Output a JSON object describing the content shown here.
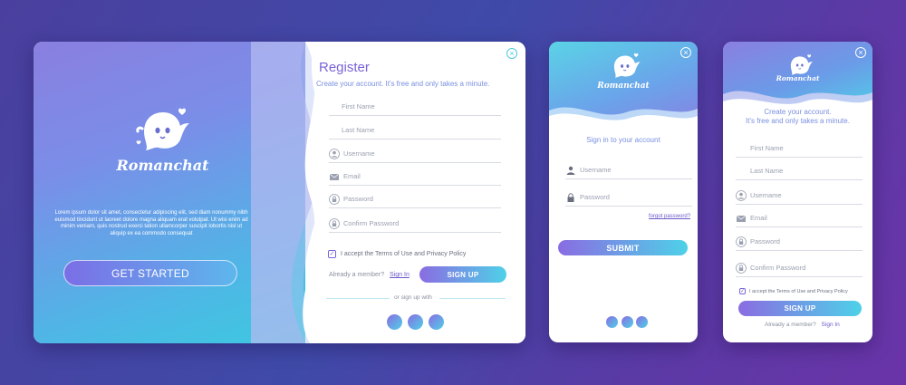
{
  "brand": {
    "name": "Romanchat"
  },
  "register_desktop": {
    "lorem": "Lorem ipsum dolor sit amet, consectetur adipiscing elit, sed diam nonummy nibh euismod tincidunt ut laoreet dolore magna aliquam erat volutpat. Ut wisi enim ad minim veniam, quis nostrud exerci tation ullamcorper suscipit lobortis nisl ut aliquip ex ea commodo consequat",
    "get_started": "GET STARTED",
    "title": "Register",
    "subtitle": "Create your account. It's free and only takes a minute.",
    "fields": [
      {
        "label": "First Name",
        "icon": "none"
      },
      {
        "label": "Last Name",
        "icon": "none"
      },
      {
        "label": "Username",
        "icon": "user-icon"
      },
      {
        "label": "Email",
        "icon": "mail-icon"
      },
      {
        "label": "Password",
        "icon": "lock-icon"
      },
      {
        "label": "Confirm Password",
        "icon": "lock-icon"
      }
    ],
    "terms": "I accept the Terms of Use and Privacy Policy",
    "already": "Already a member?",
    "sign_in": "Sign In",
    "sign_up": "SIGN UP",
    "or_sign_up": "or sign up with",
    "close": "×"
  },
  "signin_mobile": {
    "title": "Sign in to your account",
    "username": "Username",
    "password": "Password",
    "forgot": "forgot password?",
    "submit": "SUBMIT",
    "close": "×"
  },
  "register_mobile": {
    "subtitle_line1": "Create your account.",
    "subtitle_line2": "It's free and only takes a minute.",
    "fields": [
      {
        "label": "First Name",
        "icon": "none"
      },
      {
        "label": "Last Name",
        "icon": "none"
      },
      {
        "label": "Username",
        "icon": "user-icon"
      },
      {
        "label": "Email",
        "icon": "mail-icon"
      },
      {
        "label": "Password",
        "icon": "lock-icon"
      },
      {
        "label": "Confirm Password",
        "icon": "lock-icon"
      }
    ],
    "terms": "I accept the Terms of Use and Privacy Policy",
    "sign_up": "SIGN UP",
    "already": "Already a member?",
    "sign_in": "Sign In",
    "close": "×"
  },
  "colors": {
    "accent_purple": "#7a64d8",
    "accent_cyan": "#4ed1e8"
  }
}
